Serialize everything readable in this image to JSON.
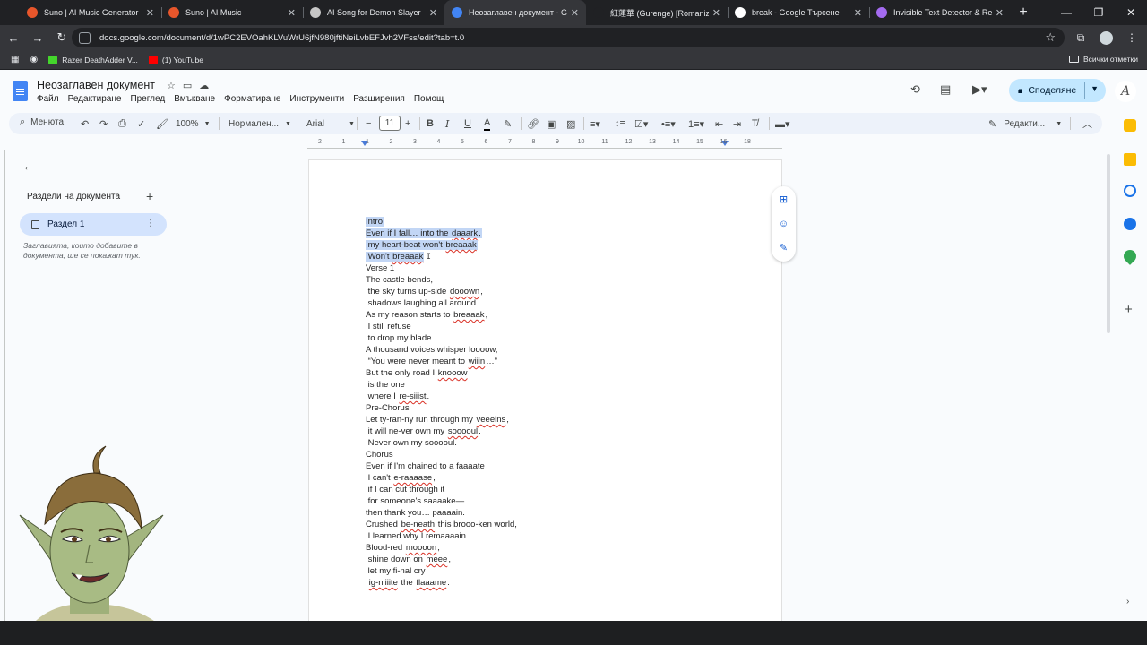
{
  "browser": {
    "tabs": [
      {
        "title": "Suno | AI Music Generator",
        "color": "#e8562b"
      },
      {
        "title": "Suno | AI Music",
        "color": "#e8562b"
      },
      {
        "title": "AI Song for Demon Slayer",
        "color": "#c6c6c6"
      },
      {
        "title": "Неозаглавен документ - Goog",
        "color": "#4285f4",
        "active": true
      },
      {
        "title": "紅蓮華 (Gurenge) [Romanized]",
        "color": "#202124"
      },
      {
        "title": "break - Google Търсене",
        "color": "#ffffff"
      },
      {
        "title": "Invisible Text Detector & Remo",
        "color": "#a46bf0"
      }
    ],
    "new_tab_label": "+",
    "url": "docs.google.com/document/d/1wPC2EVOahKLVuWrU6jfN980jftiNeiLvbEFJvh2VFss/edit?tab=t.0",
    "bookmarks": [
      {
        "label": "Razer DeathAdder V...",
        "color": "#44d62c"
      },
      {
        "label": "(1) YouTube",
        "color": "#ff0000"
      }
    ],
    "all_bookmarks_label": "Всички отметки"
  },
  "docs": {
    "title": "Неозаглавен документ",
    "menu": [
      "Файл",
      "Редактиране",
      "Преглед",
      "Вмъкване",
      "Форматиране",
      "Инструменти",
      "Разширения",
      "Помощ"
    ],
    "share_label": "Споделяне",
    "user_initial": "A",
    "toolbar": {
      "menus_label": "Менюта",
      "zoom": "100%",
      "style": "Нормален...",
      "font": "Arial",
      "font_size": "11",
      "editing_mode": "Редакти..."
    },
    "ruler_numbers": [
      "2",
      "1",
      "1",
      "2",
      "3",
      "4",
      "5",
      "6",
      "7",
      "8",
      "9",
      "10",
      "11",
      "12",
      "13",
      "14",
      "15",
      "16",
      "18"
    ],
    "sidebar": {
      "heading": "Раздели на документа",
      "add_label": "+",
      "section_label": "Раздел 1",
      "hint": "Заглавията, които добавите в документа, ще се покажат тук."
    },
    "lines": [
      {
        "sel": true,
        "parts": [
          {
            "t": "Intro"
          }
        ]
      },
      {
        "sel": true,
        "parts": [
          {
            "t": "Even if I fall… into the "
          },
          {
            "t": "daaark",
            "sp": true
          },
          {
            "t": ","
          }
        ]
      },
      {
        "sel": true,
        "parts": [
          {
            "t": " my heart-beat won't "
          },
          {
            "t": "breaaak",
            "sp": true
          }
        ]
      },
      {
        "sel": true,
        "parts": [
          {
            "t": " Won't "
          },
          {
            "t": "breaaak",
            "sp": true
          }
        ]
      },
      {
        "parts": [
          {
            "t": "Verse 1"
          }
        ]
      },
      {
        "parts": [
          {
            "t": "The castle bends,"
          }
        ]
      },
      {
        "parts": [
          {
            "t": " the sky turns up-side "
          },
          {
            "t": "dooown",
            "sp": true
          },
          {
            "t": ","
          }
        ]
      },
      {
        "parts": [
          {
            "t": " shadows laughing all around."
          }
        ]
      },
      {
        "parts": [
          {
            "t": "As my reason starts to "
          },
          {
            "t": "breaaak",
            "sp": true
          },
          {
            "t": ","
          }
        ]
      },
      {
        "parts": [
          {
            "t": " I still refuse"
          }
        ]
      },
      {
        "parts": [
          {
            "t": " to drop my blade."
          }
        ]
      },
      {
        "parts": [
          {
            "t": "A thousand voices whisper loooow,"
          }
        ]
      },
      {
        "parts": [
          {
            "t": " “You were never meant to "
          },
          {
            "t": "wiiin",
            "sp": true
          },
          {
            "t": "…”"
          }
        ]
      },
      {
        "parts": [
          {
            "t": "But the only road I "
          },
          {
            "t": "knooow",
            "sp": true
          }
        ]
      },
      {
        "parts": [
          {
            "t": " is the one"
          }
        ]
      },
      {
        "parts": [
          {
            "t": " where I "
          },
          {
            "t": "re-siiist",
            "sp": true
          },
          {
            "t": "."
          }
        ]
      },
      {
        "parts": [
          {
            "t": "Pre-Chorus"
          }
        ]
      },
      {
        "parts": [
          {
            "t": "Let ty-ran-ny run through my "
          },
          {
            "t": "veeeins",
            "sp": true
          },
          {
            "t": ","
          }
        ]
      },
      {
        "parts": [
          {
            "t": " it will ne-ver own my "
          },
          {
            "t": "sooooul",
            "sp": true
          },
          {
            "t": "."
          }
        ]
      },
      {
        "parts": [
          {
            "t": " Never own my sooooul."
          }
        ]
      },
      {
        "parts": [
          {
            "t": "Chorus"
          }
        ]
      },
      {
        "parts": [
          {
            "t": "Even if I'm chained to a faaaate"
          }
        ]
      },
      {
        "parts": [
          {
            "t": " I can't "
          },
          {
            "t": "e-raaaase",
            "sp": true
          },
          {
            "t": ","
          }
        ]
      },
      {
        "parts": [
          {
            "t": " if I can cut through it"
          }
        ]
      },
      {
        "parts": [
          {
            "t": " for someone's saaaake—"
          }
        ]
      },
      {
        "parts": [
          {
            "t": "then thank you… paaaain."
          }
        ]
      },
      {
        "parts": [
          {
            "t": "Crushed "
          },
          {
            "t": "be-neath",
            "sp": true
          },
          {
            "t": " this brooo-ken world,"
          }
        ]
      },
      {
        "parts": [
          {
            "t": " I learned why I remaaaain."
          }
        ]
      },
      {
        "parts": [
          {
            "t": "Blood-red "
          },
          {
            "t": "moooon",
            "sp": true
          },
          {
            "t": ","
          }
        ]
      },
      {
        "parts": [
          {
            "t": " shine down on "
          },
          {
            "t": "meee",
            "sp": true
          },
          {
            "t": ","
          }
        ]
      },
      {
        "parts": [
          {
            "t": " let my fi-nal cry"
          }
        ]
      },
      {
        "parts": [
          {
            "t": " "
          },
          {
            "t": "ig-niiiite",
            "sp": true
          },
          {
            "t": " the "
          },
          {
            "t": "flaaame",
            "sp": true
          },
          {
            "t": "."
          }
        ]
      }
    ]
  },
  "colors": {
    "accent": "#0b57d0",
    "selection": "#c2d6f5",
    "share_bg": "#c2e7ff",
    "section_bg": "#d3e3fd",
    "spellcheck": "#d93025"
  }
}
